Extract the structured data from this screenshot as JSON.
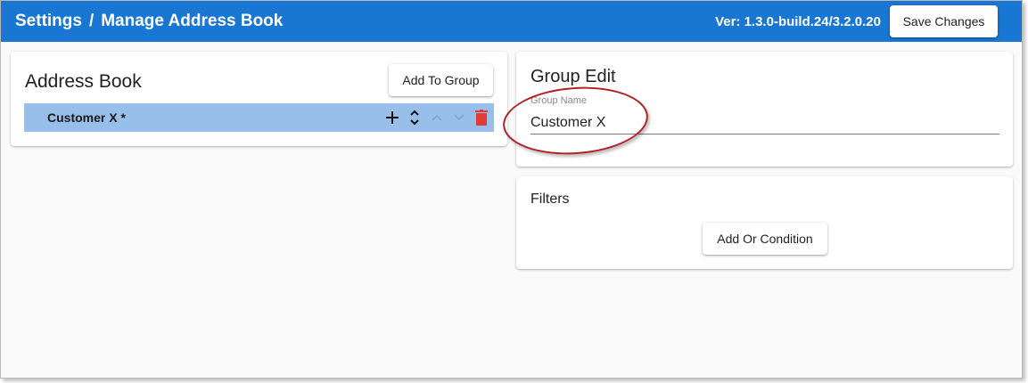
{
  "header": {
    "breadcrumb_root": "Settings",
    "breadcrumb_sep": "/",
    "breadcrumb_page": "Manage Address Book",
    "version": "Ver: 1.3.0-build.24/3.2.0.20",
    "save_label": "Save Changes",
    "color": "#1976d2"
  },
  "address_book": {
    "title": "Address Book",
    "add_to_group_label": "Add To Group",
    "items": [
      {
        "label": "Customer X *",
        "selected": true,
        "icons": [
          "plus-icon",
          "expand-collapse-icon",
          "chevron-up-icon",
          "chevron-down-icon",
          "delete-icon"
        ]
      }
    ],
    "selected_row_color": "#97bfe9",
    "delete_color": "#e53935"
  },
  "group_edit": {
    "title": "Group Edit",
    "field_label": "Group Name",
    "field_value": "Customer X"
  },
  "filters": {
    "title": "Filters",
    "add_or_condition_label": "Add Or Condition"
  },
  "annotation": {
    "shape": "ellipse",
    "color": "#b22024"
  }
}
